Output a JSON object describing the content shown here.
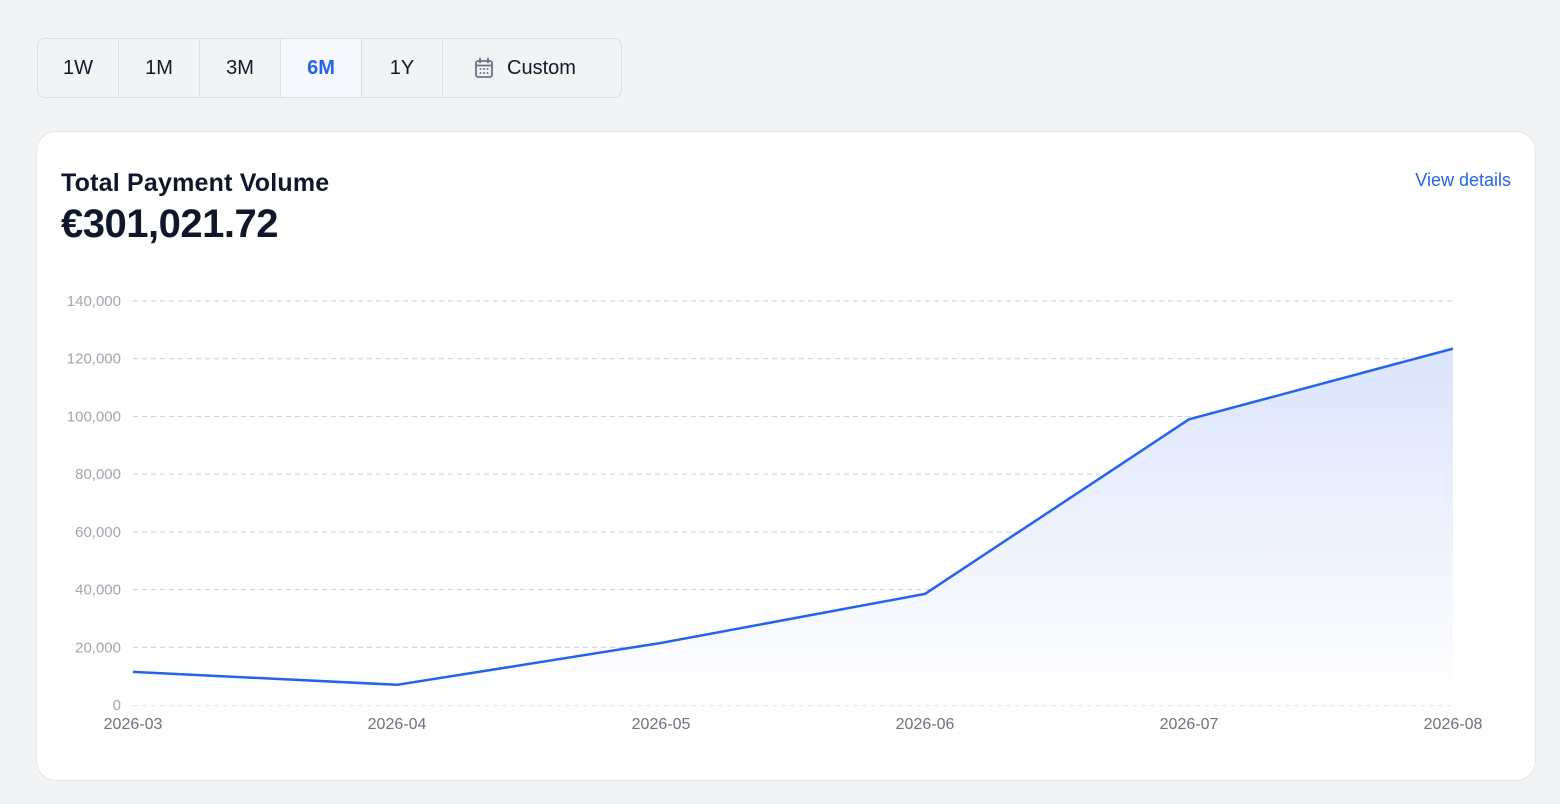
{
  "range_selector": {
    "options": [
      {
        "label": "1W",
        "active": false
      },
      {
        "label": "1M",
        "active": false
      },
      {
        "label": "3M",
        "active": false
      },
      {
        "label": "6M",
        "active": true
      },
      {
        "label": "1Y",
        "active": false
      },
      {
        "label": "Custom",
        "active": false,
        "icon": "calendar-icon"
      }
    ]
  },
  "card": {
    "title": "Total Payment Volume",
    "amount": "€301,021.72",
    "view_details_label": "View details"
  },
  "colors": {
    "accent": "#2563eb",
    "area_fill_top": "#dbe4fb",
    "gridline": "#c9cdd3"
  },
  "chart_data": {
    "type": "area",
    "categories": [
      "2026-03",
      "2026-04",
      "2026-05",
      "2026-06",
      "2026-07",
      "2026-08"
    ],
    "series": [
      {
        "values": [
          11500,
          7000,
          21500,
          38500,
          99000,
          123500
        ]
      }
    ],
    "yticks": [
      "0",
      "20,000",
      "40,000",
      "60,000",
      "80,000",
      "100,000",
      "120,000",
      "140,000"
    ],
    "ylim": [
      0,
      140000
    ],
    "grid": true,
    "legend": "none",
    "title": "",
    "xlabel": "",
    "ylabel": ""
  }
}
